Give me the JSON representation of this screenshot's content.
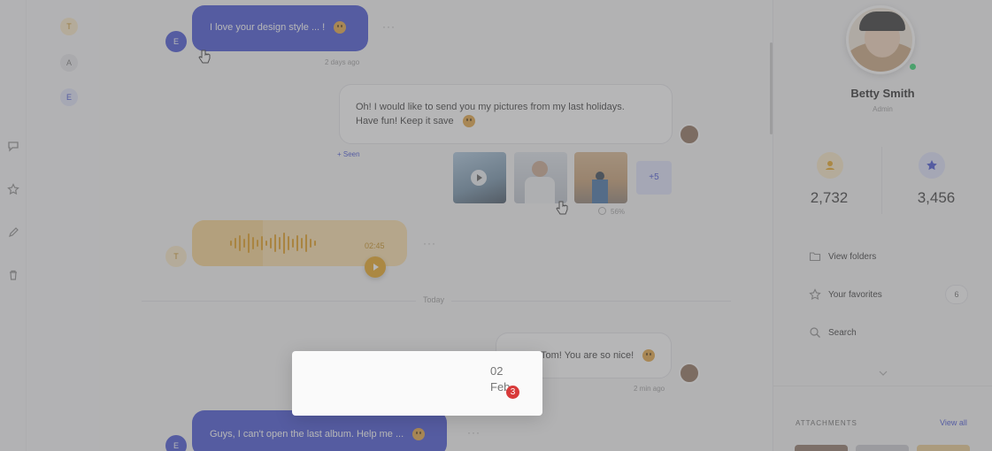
{
  "contacts": [
    {
      "initial": "T",
      "color": "#e8b23d"
    },
    {
      "initial": "A",
      "color": "#9a9aa2"
    },
    {
      "initial": "E",
      "color": "#3c4bd3"
    }
  ],
  "sidebar_icons": [
    "chat-icon",
    "star-icon",
    "pencil-icon",
    "trash-icon"
  ],
  "messages": {
    "m1": {
      "sender_initial": "E",
      "text": "I love your design style ... !",
      "time": "2 days ago"
    },
    "m2": {
      "line1": "Oh! I would like to send you my pictures from my last holidays.",
      "line2": "Have fun! Keep it save",
      "seen": "+ Seen",
      "more_photos": "+5",
      "progress": "56%"
    },
    "m3": {
      "sender_initial": "T",
      "duration": "02:45"
    },
    "divider": "Today",
    "m4": {
      "text": "Tom! You are so nice!",
      "time": "2 min ago"
    },
    "m5": {
      "sender_initial": "E",
      "text": "Guys, I can't open the last album. Help me ..."
    }
  },
  "date_popup": {
    "day": "02",
    "month": "Feb",
    "badge": "3"
  },
  "profile": {
    "name": "Betty Smith",
    "role": "Admin",
    "stat1": "2,732",
    "stat2": "3,456",
    "menu": [
      {
        "label": "View folders",
        "icon": "folder-icon"
      },
      {
        "label": "Your favorites",
        "icon": "star-icon",
        "count": "6"
      },
      {
        "label": "Search",
        "icon": "search-icon"
      }
    ],
    "attachments_label": "ATTACHMENTS",
    "view_all": "View all"
  },
  "colors": {
    "accent": "#3c4bd3",
    "orange": "#e8b23d",
    "overlay": "#6e6e70"
  }
}
